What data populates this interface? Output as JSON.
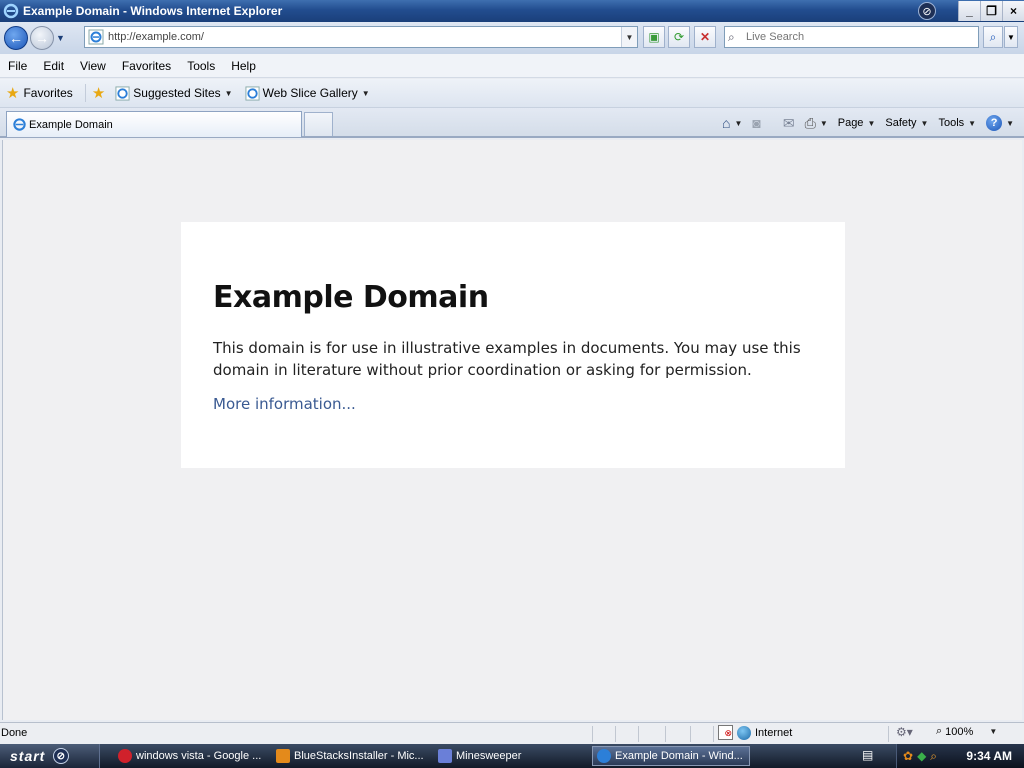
{
  "window": {
    "title": "Example Domain - Windows Internet Explorer",
    "controls": {
      "minimize": "_",
      "restore": "❐",
      "close": "×"
    }
  },
  "address_bar": {
    "url": "http://example.com/",
    "search_placeholder": "Live Search"
  },
  "menu": {
    "items": [
      "File",
      "Edit",
      "View",
      "Favorites",
      "Tools",
      "Help"
    ]
  },
  "favorites_bar": {
    "favorites_label": "Favorites",
    "items": [
      "Suggested Sites",
      "Web Slice Gallery"
    ]
  },
  "tabs": {
    "active_tab": "Example Domain"
  },
  "command_bar": {
    "items": [
      "Page",
      "Safety",
      "Tools"
    ]
  },
  "page": {
    "heading": "Example Domain",
    "body": "This domain is for use in illustrative examples in documents. You may use this domain in literature without prior coordination or asking for permission.",
    "link": "More information..."
  },
  "status_bar": {
    "status": "Done",
    "zone": "Internet",
    "zoom": "100%"
  },
  "taskbar": {
    "start_label": "start",
    "tasks": [
      {
        "label": "windows vista - Google ...",
        "icon_color": "#d0212b"
      },
      {
        "label": "BlueStacksInstaller - Mic...",
        "icon_color": "#e48a1b"
      },
      {
        "label": "Minesweeper",
        "icon_color": "#6a7fd8"
      },
      {
        "label": "Example Domain - Wind...",
        "icon_color": "#2c7fd8"
      }
    ],
    "clock": "9:34 AM"
  }
}
